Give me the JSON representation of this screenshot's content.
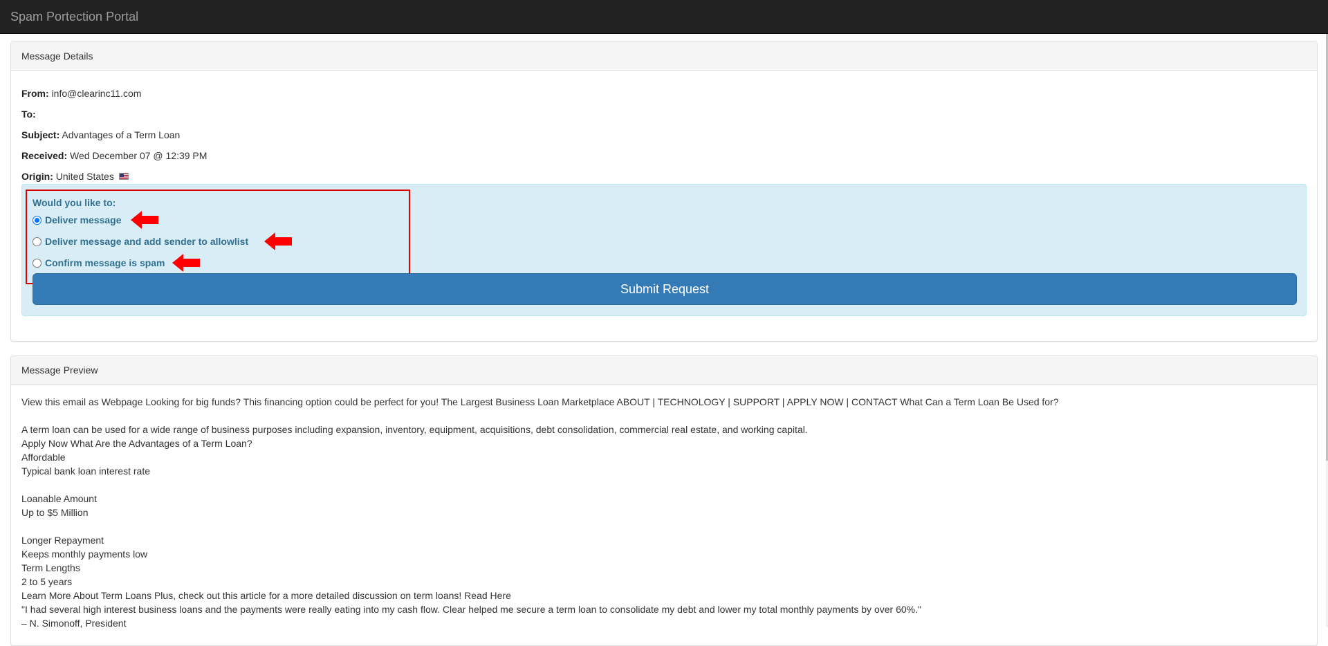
{
  "header": {
    "title": "Spam Portection Portal"
  },
  "details": {
    "heading": "Message Details",
    "from_label": "From:",
    "from_value": "info@clearinc11.com",
    "to_label": "To:",
    "to_value": "",
    "subject_label": "Subject:",
    "subject_value": "Advantages of a Term Loan",
    "received_label": "Received:",
    "received_value": "Wed December 07 @ 12:39 PM",
    "origin_label": "Origin:",
    "origin_value": "United States"
  },
  "form": {
    "question": "Would you like to:",
    "options": [
      {
        "label": "Deliver message",
        "selected": true
      },
      {
        "label": "Deliver message and add sender to allowlist",
        "selected": false
      },
      {
        "label": "Confirm message is spam",
        "selected": false
      }
    ],
    "submit_label": "Submit Request"
  },
  "preview": {
    "heading": "Message Preview",
    "line1": "View this email as Webpage Looking for big funds? This financing option could be perfect for you! The Largest Business Loan Marketplace ABOUT | TECHNOLOGY | SUPPORT | APPLY NOW | CONTACT What Can a Term Loan Be Used for?",
    "line2": "A term loan can be used for a wide range of business purposes including expansion, inventory, equipment, acquisitions, debt consolidation, commercial real estate, and working capital.",
    "line3": "Apply Now What Are the Advantages of a Term Loan?",
    "line4": "Affordable",
    "line5": "Typical bank loan interest rate",
    "line6": "Loanable Amount",
    "line7": "Up to $5 Million",
    "line8": "Longer Repayment",
    "line9": "Keeps monthly payments low",
    "line10": "Term Lengths",
    "line11": "2 to 5 years",
    "line12": "Learn More About Term Loans Plus, check out this article for a more detailed discussion on term loans! Read Here",
    "line13": "\"I had several high interest business loans and the payments were really eating into my cash flow. Clear helped me secure a term loan to consolidate my debt and lower my total monthly payments by over 60%.\"",
    "line14": "– N. Simonoff, President"
  },
  "colors": {
    "navbar": "#222222",
    "info_background": "#d9edf7",
    "info_text": "#31708f",
    "primary_button": "#337ab7",
    "highlight_red": "#e00000"
  },
  "icons": {
    "origin_flag": "us-flag-icon",
    "annotation": "red-arrow-icon"
  }
}
